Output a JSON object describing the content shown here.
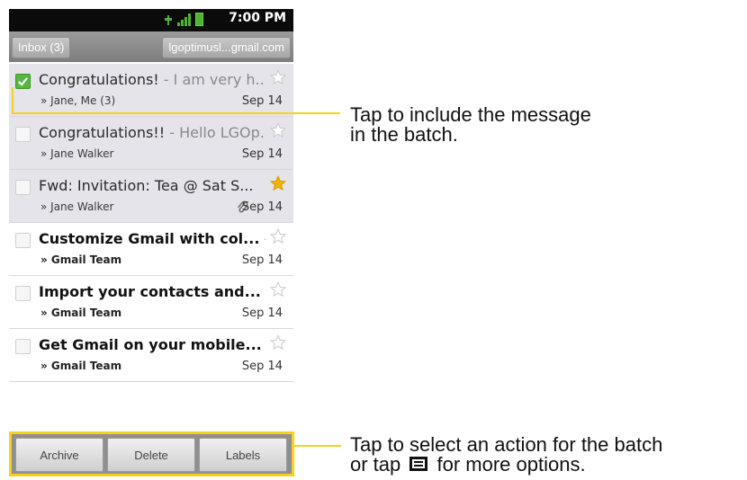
{
  "status_bar": {
    "time": "7:00 PM"
  },
  "title_bar": {
    "inbox_label": "Inbox (3)",
    "account_label": "lgoptimusl...gmail.com"
  },
  "messages": [
    {
      "subject": "Congratulations!",
      "snippet": " - I am very h...",
      "sender": "» Jane, Me (3)",
      "date": "Sep 14",
      "checked": true,
      "starred": false,
      "read": true
    },
    {
      "subject": "Congratulations!!",
      "snippet": " - Hello LGOp...",
      "sender": "» Jane Walker",
      "date": "Sep 14",
      "checked": false,
      "starred": false,
      "read": true
    },
    {
      "subject": "Fwd: Invitation: Tea @ Sat S...",
      "snippet": "",
      "sender": "» Jane Walker",
      "date": "Sep 14",
      "checked": false,
      "starred": true,
      "read": true,
      "attachment": true
    },
    {
      "subject": "Customize Gmail with col...",
      "snippet": " -...",
      "sender": "» Gmail Team",
      "date": "Sep 14",
      "checked": false,
      "starred": false,
      "read": false
    },
    {
      "subject": "Import your contacts and...",
      "snippet": "",
      "sender": "» Gmail Team",
      "date": "Sep 14",
      "checked": false,
      "starred": false,
      "read": false
    },
    {
      "subject": "Get Gmail on your mobile...",
      "snippet": "",
      "sender": "» Gmail Team",
      "date": "Sep 14",
      "checked": false,
      "starred": false,
      "read": false
    }
  ],
  "batch_actions": {
    "archive": "Archive",
    "delete": "Delete",
    "labels": "Labels"
  },
  "callouts": {
    "include_line1": "Tap to include the message",
    "include_line2": "in the batch.",
    "action_line1": "Tap to select an action for the batch",
    "action_line2_before": "or tap ",
    "action_line2_after": " for more options."
  },
  "colors": {
    "highlight": "#f6d21b",
    "check_green": "#55b83b",
    "star_gold": "#f5b400"
  }
}
